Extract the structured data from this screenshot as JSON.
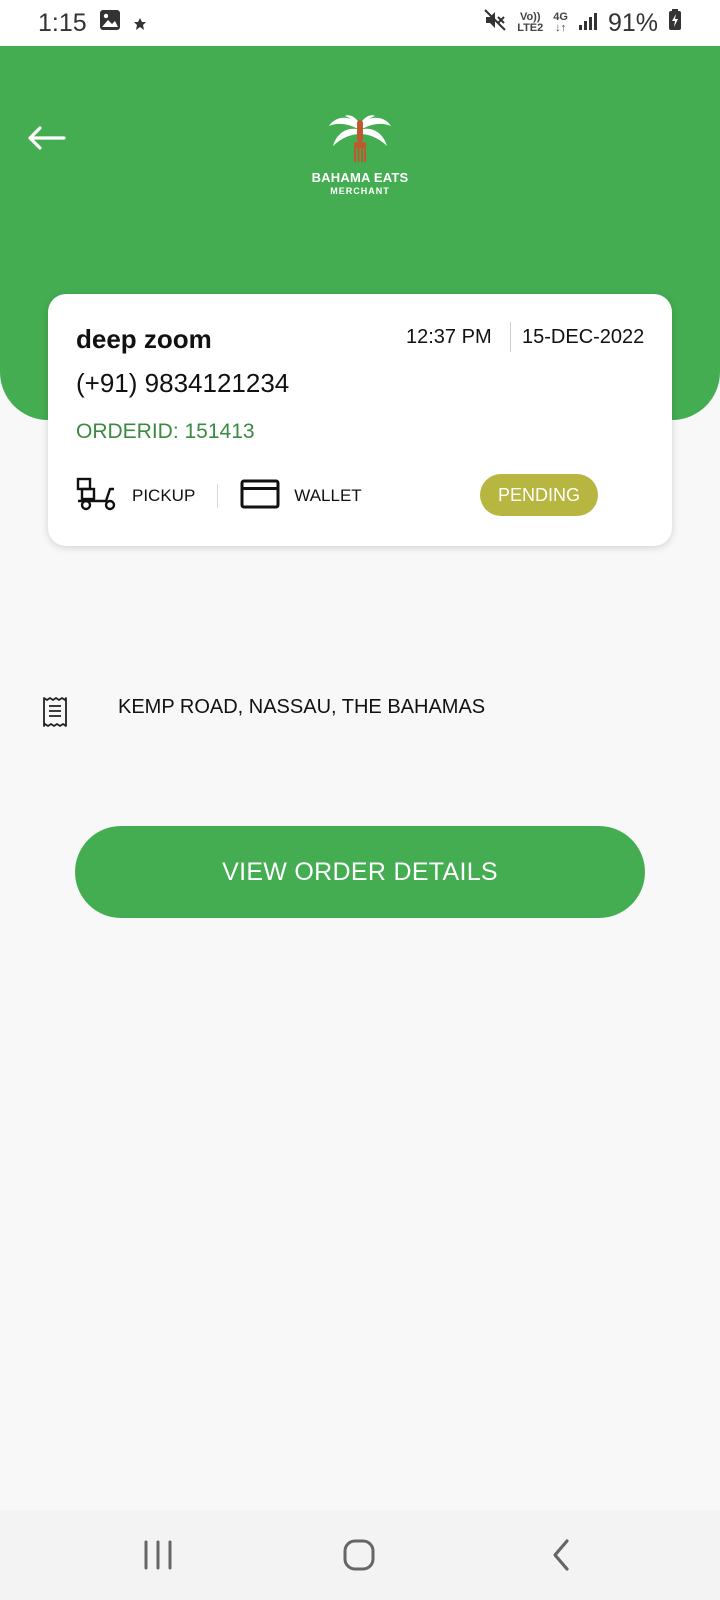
{
  "status_bar": {
    "time": "1:15",
    "volte_line1": "Vo))",
    "volte_line2": "LTE2",
    "network": "4G",
    "battery": "91%"
  },
  "header": {
    "logo_title": "BAHAMA EATS",
    "logo_subtitle": "MERCHANT",
    "accent_color": "#44ad52"
  },
  "order": {
    "customer_name": "deep zoom",
    "phone": "(+91) 9834121234",
    "order_id": "ORDERID: 151413",
    "time": "12:37 PM",
    "date": "15-DEC-2022",
    "delivery_type": "PICKUP",
    "payment_method": "WALLET",
    "status": "PENDING",
    "status_color": "#b7b640"
  },
  "address": {
    "text": "KEMP ROAD, NASSAU, THE BAHAMAS",
    "icon": "receipt-icon"
  },
  "actions": {
    "view_details_label": "VIEW ORDER DETAILS"
  },
  "nav": {
    "icons": [
      "recent-apps-icon",
      "home-icon",
      "back-icon"
    ]
  }
}
